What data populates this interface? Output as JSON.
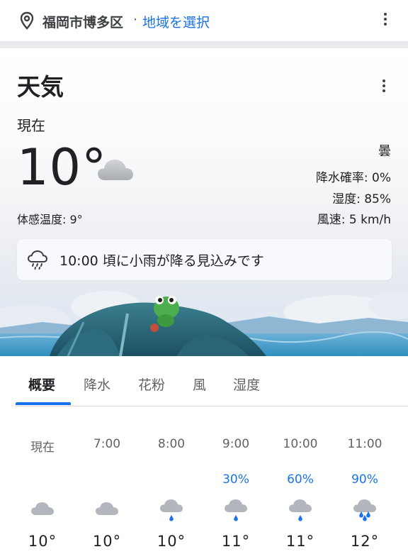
{
  "location_bar": {
    "pin_icon": "location-pin-icon",
    "location": "福岡市博多区",
    "separator": "·",
    "select_link": "地域を選択",
    "more_icon": "more-vert-icon"
  },
  "weather": {
    "title": "天気",
    "now_label": "現在",
    "temperature": "10°",
    "condition_icon": "cloud-icon",
    "feels_like": "体感温度: 9°",
    "condition": "曇",
    "precipitation": "降水確率: 0%",
    "humidity": "湿度: 85%",
    "wind": "風速: 5 km/h",
    "alert": {
      "icon": "drizzle-icon",
      "text": "10:00 頃に小雨が降る見込みです"
    },
    "more_icon": "more-vert-icon"
  },
  "tabs": [
    {
      "label": "概要",
      "active": true
    },
    {
      "label": "降水",
      "active": false
    },
    {
      "label": "花粉",
      "active": false
    },
    {
      "label": "風",
      "active": false
    },
    {
      "label": "湿度",
      "active": false
    }
  ],
  "hourly": [
    {
      "time": "現在",
      "precip": "",
      "icon": "cloud-icon",
      "temp": "10°"
    },
    {
      "time": "7:00",
      "precip": "",
      "icon": "cloud-icon",
      "temp": "10°"
    },
    {
      "time": "8:00",
      "precip": "",
      "icon": "light-rain-icon",
      "temp": "10°"
    },
    {
      "time": "9:00",
      "precip": "30%",
      "icon": "light-rain-icon",
      "temp": "11°"
    },
    {
      "time": "10:00",
      "precip": "60%",
      "icon": "light-rain-icon",
      "temp": "11°"
    },
    {
      "time": "11:00",
      "precip": "90%",
      "icon": "rain-icon",
      "temp": "12°"
    }
  ],
  "colors": {
    "accent": "#1a73e8",
    "text": "#202124",
    "secondary_text": "#5f6368"
  }
}
